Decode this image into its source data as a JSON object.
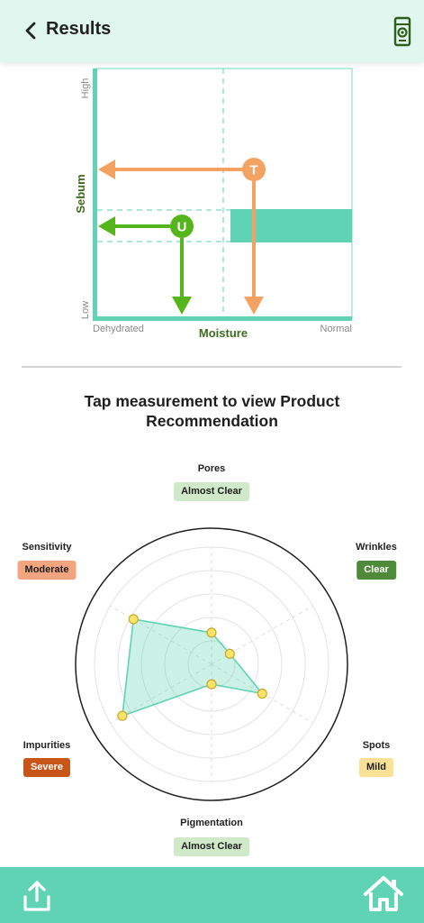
{
  "header": {
    "title": "Results"
  },
  "colors": {
    "header_bg": "#dff7ef",
    "teal": "#5fd3b4",
    "user_green": "#55b51c",
    "target_orange": "#f4a261",
    "dark_green_label": "#3e6b1f"
  },
  "icons": {
    "back": "chevron-left-icon",
    "device": "skin-scanner-device-icon",
    "share": "share-upload-icon",
    "home": "home-icon"
  },
  "moisture_sebum_chart": {
    "y_axis_title": "Sebum",
    "y_high": "High",
    "y_low": "Low",
    "x_axis_title": "Moisture",
    "x_low": "Dehydrated",
    "x_high": "Normal",
    "user_marker": "U",
    "target_marker": "T"
  },
  "instruction": "Tap measurement to view Product Recommendation",
  "categories": [
    {
      "name": "Pores",
      "status": "Almost Clear"
    },
    {
      "name": "Wrinkles",
      "status": "Clear"
    },
    {
      "name": "Spots",
      "status": "Mild"
    },
    {
      "name": "Pigmentation",
      "status": "Almost Clear"
    },
    {
      "name": "Impurities",
      "status": "Severe"
    },
    {
      "name": "Sensitivity",
      "status": "Moderate"
    }
  ],
  "chart_data": {
    "type": "radar",
    "axes": [
      "Pores",
      "Wrinkles",
      "Spots",
      "Pigmentation",
      "Impurities",
      "Sensitivity"
    ],
    "values": [
      0.27,
      0.18,
      0.5,
      0.17,
      0.88,
      0.77
    ],
    "range": [
      0,
      1
    ],
    "grid_rings": 5
  }
}
